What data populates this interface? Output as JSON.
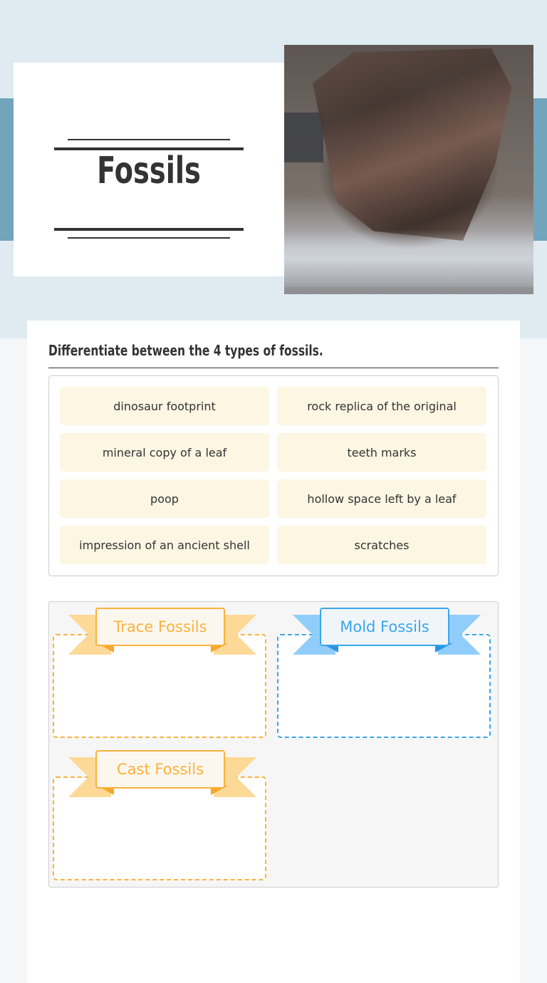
{
  "header": {
    "title": "Fossils",
    "image_alt": "photo of fossil echinoderm specimen in museum display case"
  },
  "question": {
    "prompt": "Differentiate between the 4 types of fossils."
  },
  "word_bank": {
    "items": [
      "dinosaur footprint",
      "rock replica of the original",
      "mineral copy of a leaf",
      "teeth marks",
      "poop",
      "hollow space left by a leaf",
      "impression of an ancient shell",
      "scratches"
    ]
  },
  "categories": [
    {
      "label": "Trace Fossils",
      "color": "#fbb13c",
      "light": "#fdd998",
      "label_bg": "#fcf7ee"
    },
    {
      "label": "Mold Fossils",
      "color": "#3aa6ea",
      "light": "#90cdfa",
      "label_bg": "#f0f5fa"
    },
    {
      "label": "Cast Fossils",
      "color": "#fbb13c",
      "light": "#fdd998",
      "label_bg": "#fcf7ee"
    }
  ],
  "colors": {
    "hero_bg": "#dfebf1",
    "hero_band": "#72a4bc",
    "item_bg": "#fcf6e3",
    "text": "#333333"
  }
}
